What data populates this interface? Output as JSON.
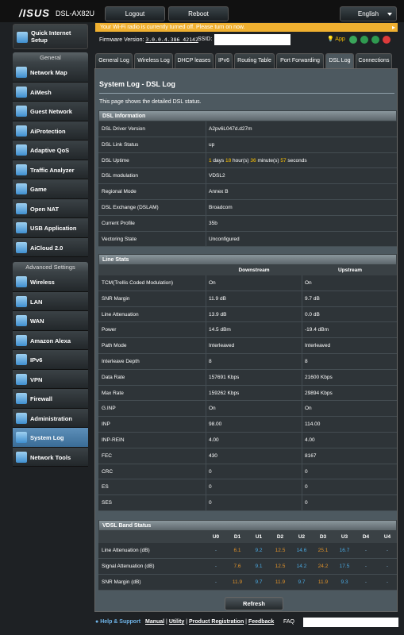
{
  "header": {
    "logo": "/ISUS",
    "model": "DSL-AX82U",
    "logout": "Logout",
    "reboot": "Reboot",
    "language": "English"
  },
  "notice": "Your Wi-Fi radio is currently turned off. Please turn on now.",
  "firmware": {
    "label": "Firmware Version:",
    "value": "3.0.0.4.386_42142",
    "ssid_label": "SSID:",
    "app_label": "App"
  },
  "sidebar": {
    "quick_setup": "Quick Internet Setup",
    "general_title": "General",
    "general_items": [
      "Network Map",
      "AiMesh",
      "Guest Network",
      "AiProtection",
      "Adaptive QoS",
      "Traffic Analyzer",
      "Game",
      "Open NAT",
      "USB Application",
      "AiCloud 2.0"
    ],
    "advanced_title": "Advanced Settings",
    "advanced_items": [
      "Wireless",
      "LAN",
      "WAN",
      "Amazon Alexa",
      "IPv6",
      "VPN",
      "Firewall",
      "Administration",
      "System Log",
      "Network Tools"
    ]
  },
  "tabs": [
    "General Log",
    "Wireless Log",
    "DHCP leases",
    "IPv6",
    "Routing Table",
    "Port Forwarding",
    "DSL Log",
    "Connections"
  ],
  "page": {
    "title": "System Log - DSL Log",
    "description": "This page shows the detailed DSL status."
  },
  "dsl_info": {
    "header": "DSL Information",
    "rows": [
      {
        "k": "DSL Driver Version",
        "v": "A2pv6L047d.d27m"
      },
      {
        "k": "DSL Link Status",
        "v": "up"
      },
      {
        "k": "DSL Uptime",
        "v": ""
      },
      {
        "k": "DSL modulation",
        "v": "VDSL2"
      },
      {
        "k": "Regional Mode",
        "v": "Annex B"
      },
      {
        "k": "DSL Exchange (DSLAM)",
        "v": "Broadcom"
      },
      {
        "k": "Current Profile",
        "v": "35b"
      },
      {
        "k": "Vectoring State",
        "v": "Unconfigured"
      }
    ],
    "uptime": {
      "days": "1",
      "days_label": " days ",
      "hours": "18",
      "hours_label": " hour(s) ",
      "minutes": "36",
      "minutes_label": " minute(s) ",
      "seconds": "57",
      "seconds_label": " seconds"
    }
  },
  "line_stats": {
    "header": "Line Stats",
    "col_down": "Downstream",
    "col_up": "Upstream",
    "rows": [
      {
        "k": "TCM(Trellis Coded Modulation)",
        "d": "On",
        "u": "On"
      },
      {
        "k": "SNR Margin",
        "d": "11.9 dB",
        "u": "9.7 dB"
      },
      {
        "k": "Line Attenuation",
        "d": "13.9 dB",
        "u": "0.0 dB"
      },
      {
        "k": "Power",
        "d": "14.5 dBm",
        "u": "-19.4 dBm"
      },
      {
        "k": "Path Mode",
        "d": "Interleaved",
        "u": "Interleaved"
      },
      {
        "k": "Interleave Depth",
        "d": "8",
        "u": "8"
      },
      {
        "k": "Data Rate",
        "d": "157691 Kbps",
        "u": "21600 Kbps"
      },
      {
        "k": "Max Rate",
        "d": "159262 Kbps",
        "u": "29894 Kbps"
      },
      {
        "k": "G.INP",
        "d": "On",
        "u": "On"
      },
      {
        "k": "INP",
        "d": "98.00",
        "u": "114.00"
      },
      {
        "k": "INP-REIN",
        "d": "4.00",
        "u": "4.00"
      },
      {
        "k": "FEC",
        "d": "430",
        "u": "8167"
      },
      {
        "k": "CRC",
        "d": "0",
        "u": "0"
      },
      {
        "k": "ES",
        "d": "0",
        "u": "0"
      },
      {
        "k": "SES",
        "d": "0",
        "u": "0"
      }
    ]
  },
  "vdsl_band": {
    "header": "VDSL Band Status",
    "bands": [
      "U0",
      "D1",
      "U1",
      "D2",
      "U2",
      "D3",
      "U3",
      "D4",
      "U4"
    ],
    "rows": [
      {
        "k": "Line Attenuation (dB)",
        "vals": [
          "-",
          "6.1",
          "9.2",
          "12.5",
          "14.6",
          "25.1",
          "16.7",
          "-",
          "-"
        ]
      },
      {
        "k": "Signal Attenuation (dB)",
        "vals": [
          "-",
          "7.6",
          "9.1",
          "12.5",
          "14.2",
          "24.2",
          "17.5",
          "-",
          "-"
        ]
      },
      {
        "k": "SNR Margin (dB)",
        "vals": [
          "-",
          "11.9",
          "9.7",
          "11.9",
          "9.7",
          "11.9",
          "9.3",
          "-",
          "-"
        ]
      }
    ]
  },
  "refresh": "Refresh",
  "footer": {
    "help": "Help & Support",
    "manual": "Manual",
    "utility": "Utility",
    "product_registration": "Product Registration",
    "feedback": "Feedback",
    "faq": "FAQ"
  },
  "colors": {
    "accent_yellow": "#ffc400",
    "down_color": "#e0922a",
    "up_color": "#4aa8e0",
    "active_nav": "#4a7ca6"
  }
}
